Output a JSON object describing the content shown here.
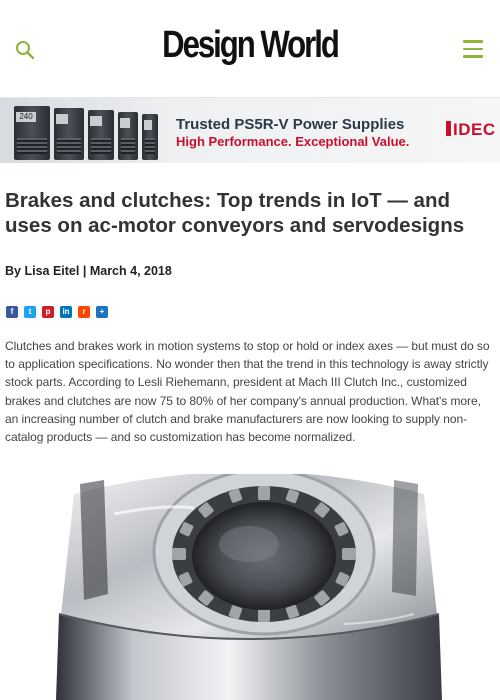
{
  "site": {
    "logo": "Design World",
    "brand_color": "#8cb43c"
  },
  "header": {
    "search_icon": "search-icon",
    "menu_icon": "hamburger-menu-icon"
  },
  "ad": {
    "title": "Trusted PS5R-V Power Supplies",
    "subtitle": "High Performance. Exceptional Value.",
    "brand": "IDEC",
    "label_1": "240",
    "accent_color": "#c8102e"
  },
  "article": {
    "title": "Brakes and clutches: Top trends in IoT — and uses on ac-motor conveyors and servodesigns",
    "by": "By",
    "author": "Lisa Eitel",
    "separator": "|",
    "date": "March 4, 2018",
    "body": "Clutches and brakes work in motion systems to stop or hold or index axes — but must do so to application specifications. No wonder then that the trend in this technology is away strictly stock parts. According to Lesli Riehemann, president at Mach III Clutch Inc., customized brakes and clutches are now 75 to 80% of her company's annual production. What's more, an increasing number of clutch and brake manufacturers are now looking to supply non-catalog products — and so customization has become normalized."
  },
  "share": [
    {
      "name": "facebook",
      "glyph": "f",
      "color": "#3b5998",
      "icon": "facebook-icon"
    },
    {
      "name": "twitter",
      "glyph": "t",
      "color": "#1da1f2",
      "icon": "twitter-icon"
    },
    {
      "name": "pinterest",
      "glyph": "p",
      "color": "#cb2027",
      "icon": "pinterest-icon"
    },
    {
      "name": "linkedin",
      "glyph": "in",
      "color": "#0077b5",
      "icon": "linkedin-icon"
    },
    {
      "name": "reddit",
      "glyph": "r",
      "color": "#ff4500",
      "icon": "reddit-icon"
    },
    {
      "name": "more",
      "glyph": "+",
      "color": "#1e73be",
      "icon": "share-more-icon"
    }
  ]
}
